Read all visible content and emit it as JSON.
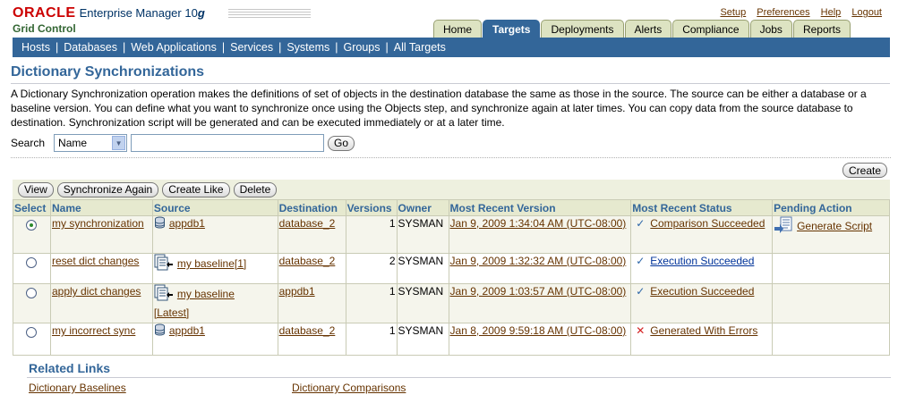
{
  "brand": {
    "oracle": "ORACLE",
    "product": "Enterprise Manager 10",
    "product_version": "g",
    "subtitle": "Grid Control"
  },
  "global_links": [
    "Setup",
    "Preferences",
    "Help",
    "Logout"
  ],
  "tabs": [
    "Home",
    "Targets",
    "Deployments",
    "Alerts",
    "Compliance",
    "Jobs",
    "Reports"
  ],
  "active_tab": "Targets",
  "subnav": [
    "Hosts",
    "Databases",
    "Web Applications",
    "Services",
    "Systems",
    "Groups",
    "All Targets"
  ],
  "page": {
    "title": "Dictionary Synchronizations",
    "description": "A Dictionary Synchronization operation makes the definitions of set of objects in the destination database the same as those in the source. The source can be either a database or a baseline version. You can define what you want to synchronize once using the Objects step, and synchronize again at later times. You can copy data from the source database to destination. Synchronization script will be generated and can be executed immediately or at a later time."
  },
  "search": {
    "label": "Search",
    "selected": "Name",
    "value": "",
    "go_label": "Go"
  },
  "create_label": "Create",
  "actions": [
    "View",
    "Synchronize Again",
    "Create Like",
    "Delete"
  ],
  "table": {
    "columns": [
      "Select",
      "Name",
      "Source",
      "Destination",
      "Versions",
      "Owner",
      "Most Recent Version",
      "Most Recent Status",
      "Pending Action"
    ],
    "rows": [
      {
        "selected": true,
        "name": "my synchronization",
        "source": "appdb1",
        "source_type": "database-icon",
        "source_suffix": "",
        "destination": "database_2",
        "versions": "1",
        "owner": "SYSMAN",
        "most_recent_version": "Jan 9, 2009 1:34:04 AM (UTC-08:00)",
        "status": "Comparison Succeeded",
        "status_icon": "check-icon",
        "pending": "Generate Script"
      },
      {
        "selected": false,
        "name": "reset dict changes",
        "source": "my baseline[1]",
        "source_type": "baseline-icon",
        "source_suffix": "",
        "destination": "database_2",
        "versions": "2",
        "owner": "SYSMAN",
        "most_recent_version": "Jan 9, 2009 1:32:32 AM (UTC-08:00)",
        "status": "Execution Succeeded",
        "status_icon": "check-icon",
        "pending": ""
      },
      {
        "selected": false,
        "name": "apply dict changes",
        "source": "my baseline",
        "source_type": "baseline-icon",
        "source_suffix": "[Latest]",
        "destination": "appdb1",
        "versions": "1",
        "owner": "SYSMAN",
        "most_recent_version": "Jan 9, 2009 1:03:57 AM (UTC-08:00)",
        "status": "Execution Succeeded",
        "status_icon": "check-icon",
        "pending": ""
      },
      {
        "selected": false,
        "name": "my incorrect sync",
        "source": "appdb1",
        "source_type": "database-icon",
        "source_suffix": "",
        "destination": "database_2",
        "versions": "1",
        "owner": "SYSMAN",
        "most_recent_version": "Jan 8, 2009 9:59:18 AM (UTC-08:00)",
        "status": "Generated With Errors",
        "status_icon": "error-icon",
        "pending": ""
      }
    ]
  },
  "related": {
    "title": "Related Links",
    "links": [
      "Dictionary Baselines",
      "Dictionary Comparisons"
    ]
  }
}
